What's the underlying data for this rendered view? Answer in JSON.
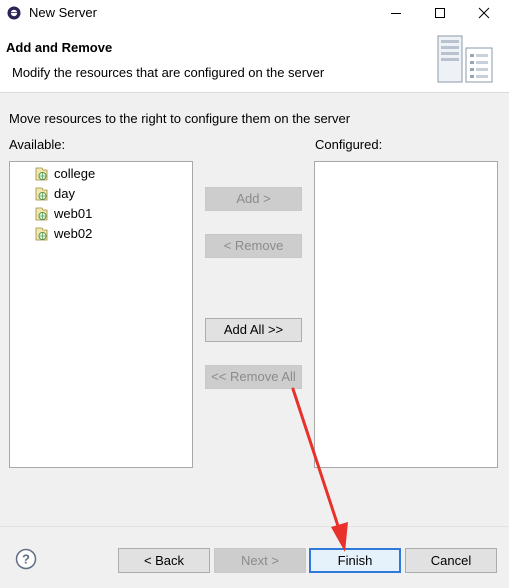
{
  "window": {
    "title": "New Server"
  },
  "header": {
    "title": "Add and Remove",
    "description": "Modify the resources that are configured on the server"
  },
  "instruction": "Move resources to the right to configure them on the server",
  "available": {
    "label": "Available:",
    "items": [
      "college",
      "day",
      "web01",
      "web02"
    ]
  },
  "configured": {
    "label": "Configured:",
    "items": []
  },
  "buttons": {
    "add": "Add >",
    "remove": "< Remove",
    "add_all": "Add All >>",
    "remove_all": "<< Remove All"
  },
  "footer": {
    "back": "< Back",
    "next": "Next >",
    "finish": "Finish",
    "cancel": "Cancel"
  },
  "colors": {
    "annotation_arrow": "#e8312b",
    "default_button_border": "#2f7ad8"
  }
}
